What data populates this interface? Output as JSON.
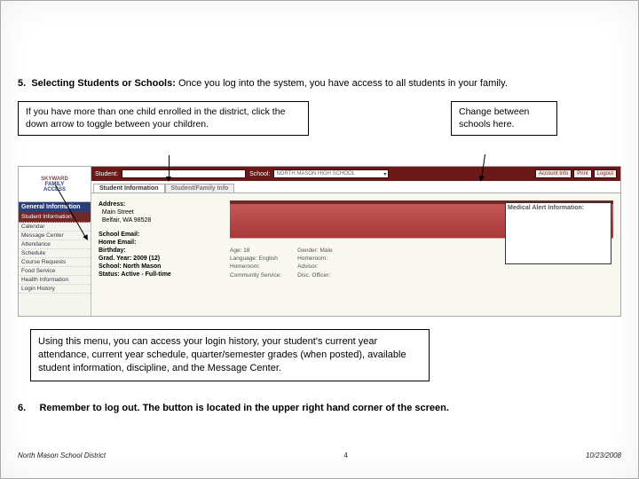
{
  "heading": {
    "num": "5.",
    "title": "Selecting Students or Schools:",
    "rest": " Once you log into the system, you have access to all students in your family."
  },
  "callout1": "If you have more than one child enrolled in the district, click the down arrow to toggle between your children.",
  "callout2": "Change between schools here.",
  "topbar": {
    "student_label": "Student:",
    "school_label": "School:",
    "school_value": "NORTH MASON HIGH SCHOOL",
    "btn_account": "Account Info",
    "btn_print": "Print",
    "btn_logout": "Logout"
  },
  "tabs": {
    "t1": "Student Information",
    "t2": "Student/Family Info"
  },
  "logo": {
    "line1": "SKYWARD",
    "line2": "FAMILY",
    "line3": "ACCESS"
  },
  "nav": {
    "header": "General Information",
    "items": [
      "Student Information",
      "Calendar",
      "Message Center",
      "Attendance",
      "Schedule",
      "Course Requests",
      "Food Service",
      "Health Information",
      "Login History"
    ],
    "active_index": 0
  },
  "info": {
    "address_label": "Address:",
    "address_l1": "Main Street",
    "address_l2": "Belfair, WA 98528",
    "school_email": "School Email:",
    "home_email": "Home Email:",
    "birthday": "Birthday:",
    "grad_year": "Grad. Year: 2009 (12)",
    "school": "School: North Mason",
    "status": "Status: Active - Full-time",
    "medical": "Medical Alert Information:",
    "mid_left": {
      "k1": "Age:",
      "v1": "18",
      "k2": "Language:",
      "v2": "English",
      "k3": "Homeroom:",
      "v3": "",
      "k4": "Community Service:",
      "v4": ""
    },
    "mid_right": {
      "k1": "Gender:",
      "v1": "Male",
      "k2": "Homeroom:",
      "v2": "",
      "k3": "Advisor:",
      "v3": "",
      "k4": "Disc. Officer:",
      "v4": ""
    }
  },
  "callout3": "Using this menu, you can access your login history, your student's current year attendance, current year schedule, quarter/semester grades (when posted), available student information, discipline, and the Message Center.",
  "item6": {
    "num": "6.",
    "text": "Remember to log out.  The button is located in the upper right hand corner of the screen."
  },
  "footer": {
    "left": "North Mason School District",
    "page": "4",
    "right": "10/23/2008"
  }
}
